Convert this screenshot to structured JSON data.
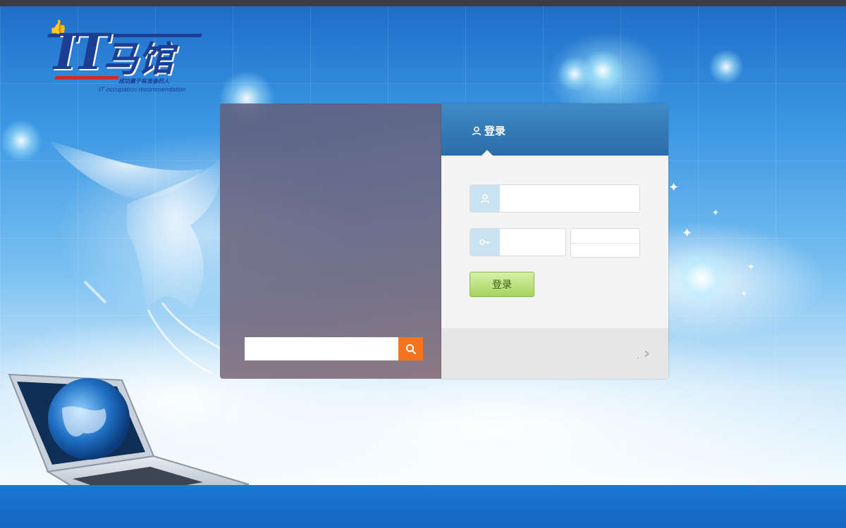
{
  "logo": {
    "it_text": "IT",
    "cn_text": "马馆",
    "slogan": "成功属于有准备的人",
    "subtitle": "IT occupation recommendation"
  },
  "search": {
    "placeholder": "",
    "button_icon": "search-icon"
  },
  "login": {
    "title": "登录",
    "title_icon": "user-icon",
    "username_icon": "user-icon",
    "username_value": "",
    "password_icon": "key-icon",
    "password_value": "",
    "captcha_value": "",
    "submit_label": "登录",
    "footer_mark": ".",
    "footer_arrow_icon": "chevron-right-icon"
  },
  "colors": {
    "header_blue": "#2a6ca8",
    "search_orange": "#f5741f",
    "button_green": "#a6d45e",
    "bottom_band": "#1565c3"
  }
}
